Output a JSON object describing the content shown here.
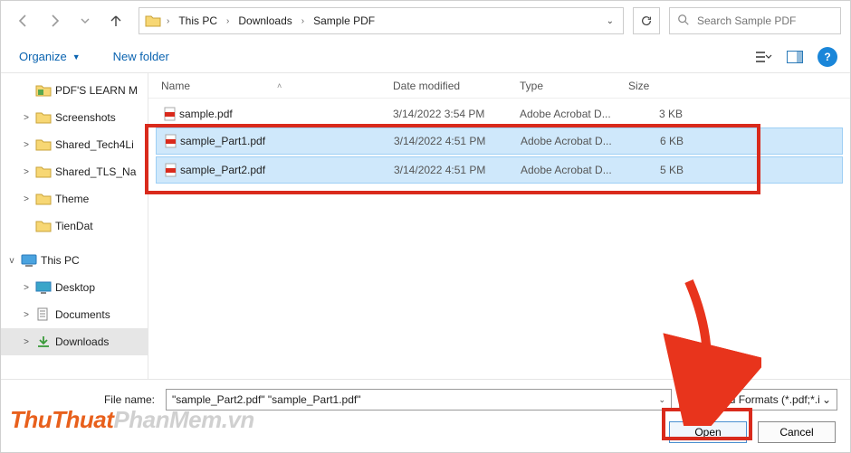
{
  "breadcrumbs": [
    "This PC",
    "Downloads",
    "Sample PDF"
  ],
  "search": {
    "placeholder": "Search Sample PDF"
  },
  "toolbar": {
    "organize": "Organize",
    "newfolder": "New folder"
  },
  "sidebar": {
    "items": [
      {
        "label": "PDF'S LEARN M",
        "icon": "folder-green",
        "expander": ""
      },
      {
        "label": "Screenshots",
        "icon": "folder",
        "expander": ">"
      },
      {
        "label": "Shared_Tech4Li",
        "icon": "folder",
        "expander": ">"
      },
      {
        "label": "Shared_TLS_Na",
        "icon": "folder",
        "expander": ">"
      },
      {
        "label": "Theme",
        "icon": "folder",
        "expander": ">"
      },
      {
        "label": "TienDat",
        "icon": "folder",
        "expander": ""
      }
    ],
    "thispc": {
      "label": "This PC",
      "expander": "v"
    },
    "pcitems": [
      {
        "label": "Desktop",
        "icon": "desktop",
        "expander": ">"
      },
      {
        "label": "Documents",
        "icon": "documents",
        "expander": ">"
      },
      {
        "label": "Downloads",
        "icon": "downloads",
        "expander": ">",
        "selected": true
      }
    ]
  },
  "columns": {
    "name": "Name",
    "date": "Date modified",
    "type": "Type",
    "size": "Size"
  },
  "files": [
    {
      "name": "sample.pdf",
      "date": "3/14/2022 3:54 PM",
      "type": "Adobe Acrobat D...",
      "size": "3 KB",
      "selected": false
    },
    {
      "name": "sample_Part1.pdf",
      "date": "3/14/2022 4:51 PM",
      "type": "Adobe Acrobat D...",
      "size": "6 KB",
      "selected": true
    },
    {
      "name": "sample_Part2.pdf",
      "date": "3/14/2022 4:51 PM",
      "type": "Adobe Acrobat D...",
      "size": "5 KB",
      "selected": true
    }
  ],
  "filename": {
    "label": "File name:",
    "value": "\"sample_Part2.pdf\" \"sample_Part1.pdf\""
  },
  "filter": {
    "label": "Supported Formats (*.pdf;*.i"
  },
  "buttons": {
    "open": "Open",
    "cancel": "Cancel"
  },
  "watermark": {
    "part1": "ThuThuat",
    "part2": "PhanMem.vn"
  }
}
